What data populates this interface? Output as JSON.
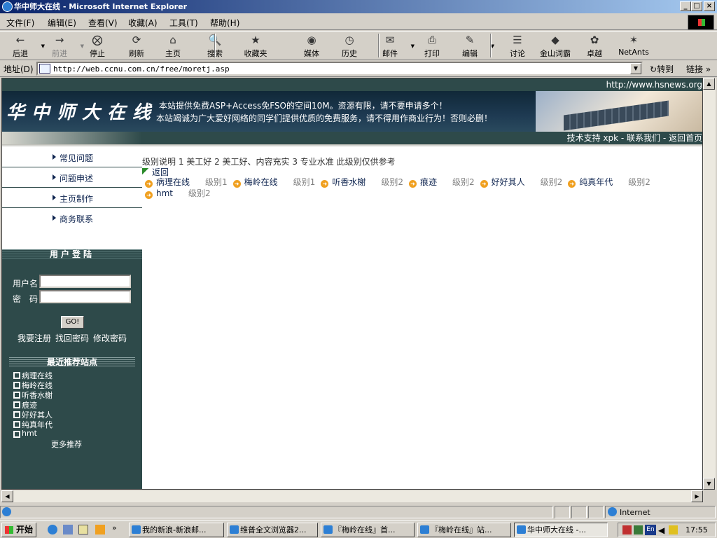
{
  "window": {
    "title": "华中师大在线 - Microsoft Internet Explorer",
    "controls": [
      "_",
      "□",
      "×"
    ]
  },
  "menu": [
    "文件(F)",
    "编辑(E)",
    "查看(V)",
    "收藏(A)",
    "工具(T)",
    "帮助(H)"
  ],
  "toolbar": [
    {
      "label": "后退",
      "icon": "←",
      "name": "back"
    },
    {
      "label": "前进",
      "icon": "→",
      "name": "forward"
    },
    {
      "label": "停止",
      "icon": "⨂",
      "name": "stop"
    },
    {
      "label": "刷新",
      "icon": "⟳",
      "name": "refresh"
    },
    {
      "label": "主页",
      "icon": "⌂",
      "name": "home"
    },
    {
      "label": "搜索",
      "icon": "🔍",
      "name": "search"
    },
    {
      "label": "收藏夹",
      "icon": "★",
      "name": "favorites"
    },
    {
      "label": "媒体",
      "icon": "◉",
      "name": "media"
    },
    {
      "label": "历史",
      "icon": "◷",
      "name": "history"
    },
    {
      "label": "邮件",
      "icon": "✉",
      "name": "mail"
    },
    {
      "label": "打印",
      "icon": "⎙",
      "name": "print"
    },
    {
      "label": "编辑",
      "icon": "✎",
      "name": "edit"
    },
    {
      "label": "讨论",
      "icon": "☰",
      "name": "discuss"
    },
    {
      "label": "金山词霸",
      "icon": "◆",
      "name": "ciba"
    },
    {
      "label": "卓越",
      "icon": "✿",
      "name": "joyo"
    },
    {
      "label": "NetAnts",
      "icon": "✶",
      "name": "netants"
    }
  ],
  "address": {
    "label": "地址(D)",
    "url": "http://web.ccnu.com.cn/free/moretj.asp",
    "go": "转到",
    "links": "链接"
  },
  "page": {
    "topurl": "http://www.hsnews.org",
    "logo": "华中师大在线",
    "notice1": "本站提供免费ASP+Access免FSO的空间10M。资源有限，请不要申请多个！",
    "notice2": "本站竭诚为广大爱好网络的同学们提供优质的免费服务，请不得用作商业行为！否则必删！",
    "subbar": "技术支持 xpk - 联系我们 - 返回首页",
    "leftmenu": [
      "常见问题",
      "问题申述",
      "主页制作",
      "商务联系"
    ],
    "login": {
      "title": "用户登陆",
      "username": "用户名",
      "password": "密　码",
      "go": "GO!",
      "links": [
        "我要注册",
        "找回密码",
        "修改密码"
      ]
    },
    "recommend": {
      "title": "最近推荐站点",
      "items": [
        "病理在线",
        "梅岭在线",
        "听香水榭",
        "痕迹",
        "好好其人",
        "纯真年代",
        "hmt"
      ],
      "more": "更多推荐"
    },
    "levels": "级别说明 1 美工好 2 美工好、内容充实 3 专业水准 此级别仅供参考",
    "back": "返回",
    "sites": [
      {
        "name": "病理在线",
        "level": "级别1"
      },
      {
        "name": "梅岭在线",
        "level": "级别1"
      },
      {
        "name": "听香水榭",
        "level": "级别2"
      },
      {
        "name": "痕迹",
        "level": "级别2"
      },
      {
        "name": "好好其人",
        "level": "级别2"
      },
      {
        "name": "纯真年代",
        "level": "级别2"
      },
      {
        "name": "hmt",
        "level": "级别2"
      }
    ]
  },
  "status": {
    "zone": "Internet"
  },
  "taskbar": {
    "start": "开始",
    "tasks": [
      "我的新浪-新浪邮...",
      "维普全文浏览器2...",
      "『梅岭在线』首...",
      "『梅岭在线』站...",
      "华中师大在线 -..."
    ],
    "active": 4,
    "clock": "17:55",
    "ime": "En"
  }
}
